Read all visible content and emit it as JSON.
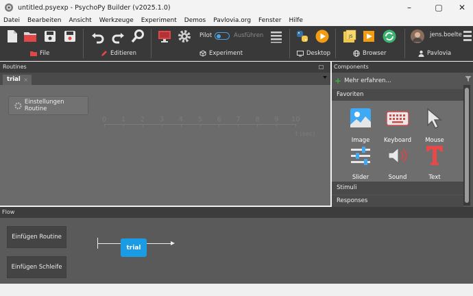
{
  "window": {
    "title": "untitled.psyexp - PsychoPy Builder (v2025.1.0)",
    "controls": [
      "–",
      "▢",
      "✕"
    ]
  },
  "menu": [
    "Datei",
    "Bearbeiten",
    "Ansicht",
    "Werkzeuge",
    "Experiment",
    "Demos",
    "Pavlovia.org",
    "Fenster",
    "Hilfe"
  ],
  "toolbar": {
    "groups": {
      "file": "File",
      "edit": "Editieren",
      "experiment": "Experiment",
      "desktop": "Desktop",
      "browser": "Browser",
      "pavlovia": "Pavlovia"
    },
    "pilot_label": "Pilot",
    "run_label": "Ausführen",
    "user_name": "jens.boelte"
  },
  "routines": {
    "header": "Routines",
    "tab": "trial",
    "tab_close": "×",
    "settings_button": "Einstellungen Routine",
    "timeline": [
      "0",
      "1",
      "2",
      "3",
      "4",
      "5",
      "6",
      "7",
      "8",
      "9",
      "10"
    ],
    "timeline_unit": "t (sec)"
  },
  "components": {
    "header": "Components",
    "more": "Mehr erfahren...",
    "favorites_header": "Favoriten",
    "items": [
      {
        "label": "Image",
        "icon": "image-icon"
      },
      {
        "label": "Keyboard",
        "icon": "keyboard-icon"
      },
      {
        "label": "Mouse",
        "icon": "mouse-icon"
      },
      {
        "label": "Slider",
        "icon": "slider-icon"
      },
      {
        "label": "Sound",
        "icon": "sound-icon"
      },
      {
        "label": "Text",
        "icon": "text-icon"
      }
    ],
    "categories": [
      "Stimuli",
      "Responses"
    ]
  },
  "flow": {
    "header": "Flow",
    "insert_routine": "Einfügen Routine",
    "insert_loop": "Einfügen Schleife",
    "routine_block": "trial"
  },
  "colors": {
    "toolbar_bg": "#393939",
    "accent_blue": "#1a9be4",
    "favorites_bg": "#6e6e6e"
  }
}
